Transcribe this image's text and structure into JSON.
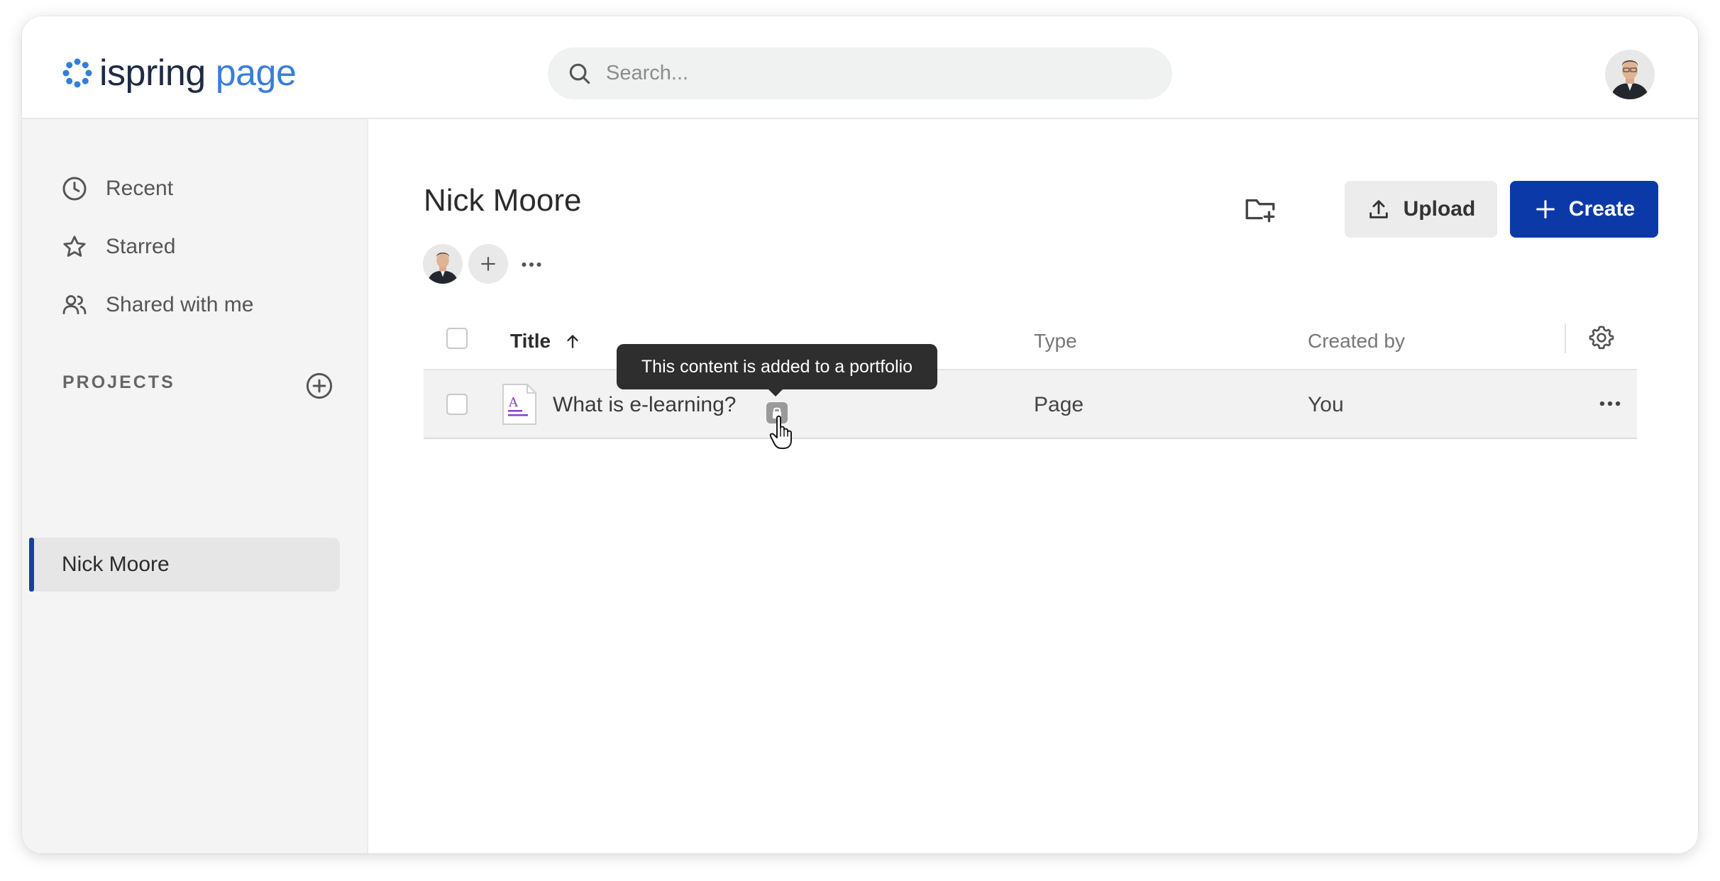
{
  "header": {
    "logo_ispring": "ispring",
    "logo_page": "page",
    "search_placeholder": "Search..."
  },
  "sidebar": {
    "items": [
      {
        "label": "Recent",
        "icon": "clock-icon"
      },
      {
        "label": "Starred",
        "icon": "star-icon"
      },
      {
        "label": "Shared with me",
        "icon": "users-icon"
      }
    ],
    "projects_label": "PROJECTS",
    "projects": [
      {
        "label": "Nick Moore",
        "selected": true
      }
    ]
  },
  "main": {
    "title": "Nick Moore",
    "upload_label": "Upload",
    "create_label": "Create",
    "table": {
      "columns": [
        "Title",
        "Type",
        "Created by"
      ],
      "sort": "ascending",
      "rows": [
        {
          "title": "What is e-learning?",
          "type": "Page",
          "created_by": "You",
          "in_portfolio": true
        }
      ]
    },
    "tooltip": "This content is added to a portfolio"
  },
  "colors": {
    "accent": "#0b3aa8",
    "logo_page": "#3a7ed8",
    "logo_mark": "#2f7fdf",
    "selected_bar": "#1c3f9c"
  }
}
